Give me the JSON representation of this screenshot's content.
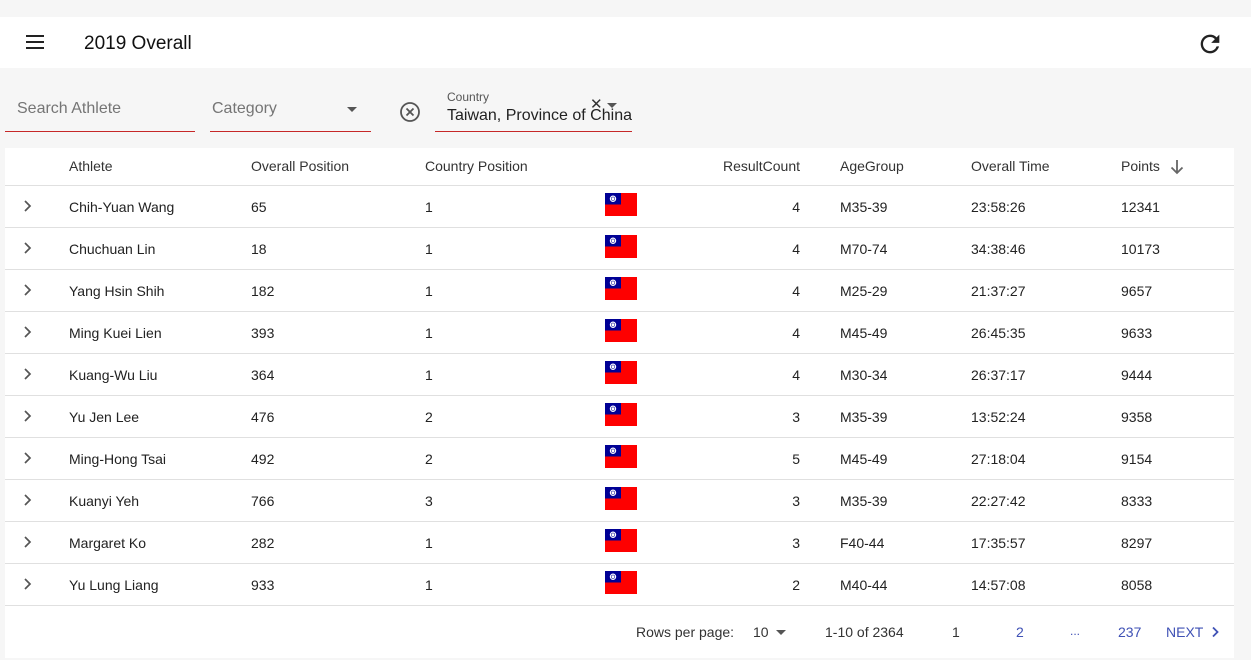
{
  "header": {
    "title": "2019 Overall"
  },
  "filters": {
    "search_placeholder": "Search Athlete",
    "category_placeholder": "Category",
    "country_label": "Country",
    "country_value": "Taiwan, Province of China"
  },
  "table": {
    "columns": [
      "Athlete",
      "Overall Position",
      "Country Position",
      "ResultCount",
      "AgeGroup",
      "Overall Time",
      "Points"
    ],
    "sort_column": "Points",
    "sort_direction": "descending",
    "rows": [
      {
        "athlete": "Chih-Yuan Wang",
        "overall": "65",
        "country": "1",
        "count": "4",
        "age": "M35-39",
        "time": "23:58:26",
        "points": "12341"
      },
      {
        "athlete": "Chuchuan Lin",
        "overall": "18",
        "country": "1",
        "count": "4",
        "age": "M70-74",
        "time": "34:38:46",
        "points": "10173"
      },
      {
        "athlete": "Yang Hsin Shih",
        "overall": "182",
        "country": "1",
        "count": "4",
        "age": "M25-29",
        "time": "21:37:27",
        "points": "9657"
      },
      {
        "athlete": "Ming Kuei Lien",
        "overall": "393",
        "country": "1",
        "count": "4",
        "age": "M45-49",
        "time": "26:45:35",
        "points": "9633"
      },
      {
        "athlete": "Kuang-Wu Liu",
        "overall": "364",
        "country": "1",
        "count": "4",
        "age": "M30-34",
        "time": "26:37:17",
        "points": "9444"
      },
      {
        "athlete": "Yu Jen Lee",
        "overall": "476",
        "country": "2",
        "count": "3",
        "age": "M35-39",
        "time": "13:52:24",
        "points": "9358"
      },
      {
        "athlete": "Ming-Hong Tsai",
        "overall": "492",
        "country": "2",
        "count": "5",
        "age": "M45-49",
        "time": "27:18:04",
        "points": "9154"
      },
      {
        "athlete": "Kuanyi Yeh",
        "overall": "766",
        "country": "3",
        "count": "3",
        "age": "M35-39",
        "time": "22:27:42",
        "points": "8333"
      },
      {
        "athlete": "Margaret Ko",
        "overall": "282",
        "country": "1",
        "count": "3",
        "age": "F40-44",
        "time": "17:35:57",
        "points": "8297"
      },
      {
        "athlete": "Yu Lung Liang",
        "overall": "933",
        "country": "1",
        "count": "2",
        "age": "M40-44",
        "time": "14:57:08",
        "points": "8058"
      }
    ]
  },
  "pagination": {
    "rows_per_page_label": "Rows per page:",
    "rows_per_page": "10",
    "range": "1-10 of 2364",
    "pages": [
      "1",
      "2",
      "...",
      "237"
    ],
    "next": "NEXT"
  },
  "colors": {
    "accent": "#3f51b5",
    "underline": "#c62828",
    "flag_red": "#fe0000",
    "flag_blue": "#000095"
  },
  "icons": [
    "menu-icon",
    "refresh-icon",
    "dropdown-caret-icon",
    "clear-circle-icon",
    "close-icon",
    "chevron-right-icon",
    "arrow-down-icon",
    "taiwan-flag-icon"
  ]
}
